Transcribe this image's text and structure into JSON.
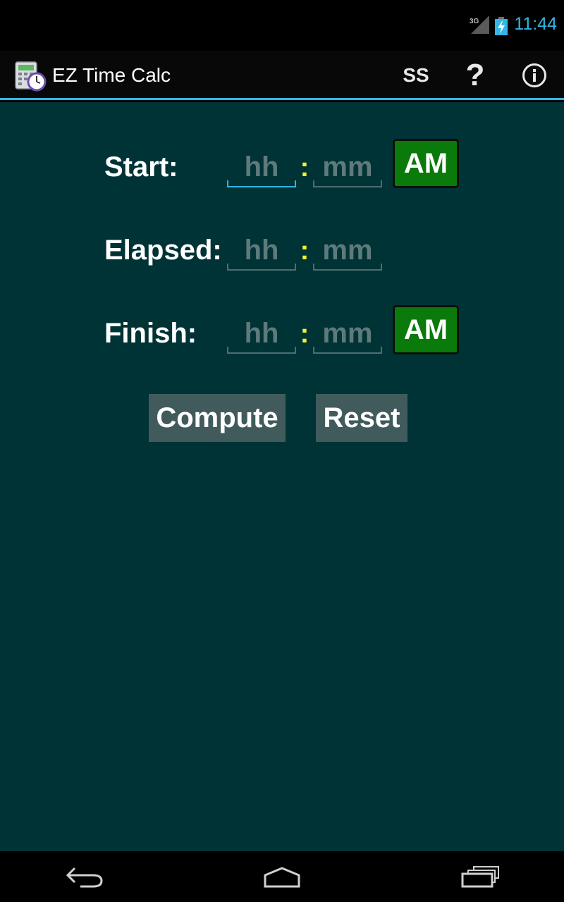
{
  "status_bar": {
    "network": "3G",
    "time": "11:44",
    "accent": "#33b5e5"
  },
  "action_bar": {
    "title": "EZ Time Calc",
    "ss_label": "SS",
    "help_label": "?",
    "info_icon": "info-icon"
  },
  "form": {
    "start": {
      "label": "Start:",
      "hh_placeholder": "hh",
      "mm_placeholder": "mm",
      "separator": ":",
      "ampm": "AM"
    },
    "elapsed": {
      "label": "Elapsed:",
      "hh_placeholder": "hh",
      "mm_placeholder": "mm",
      "separator": ":"
    },
    "finish": {
      "label": "Finish:",
      "hh_placeholder": "hh",
      "mm_placeholder": "mm",
      "separator": ":",
      "ampm": "AM"
    },
    "compute_label": "Compute",
    "reset_label": "Reset"
  },
  "colors": {
    "background": "#003336",
    "ampm_button": "#0a7a0a",
    "separator": "#f2f230",
    "action_button": "#415b5c"
  },
  "nav_bar": {
    "back_icon": "back-icon",
    "home_icon": "home-icon",
    "recents_icon": "recents-icon"
  }
}
